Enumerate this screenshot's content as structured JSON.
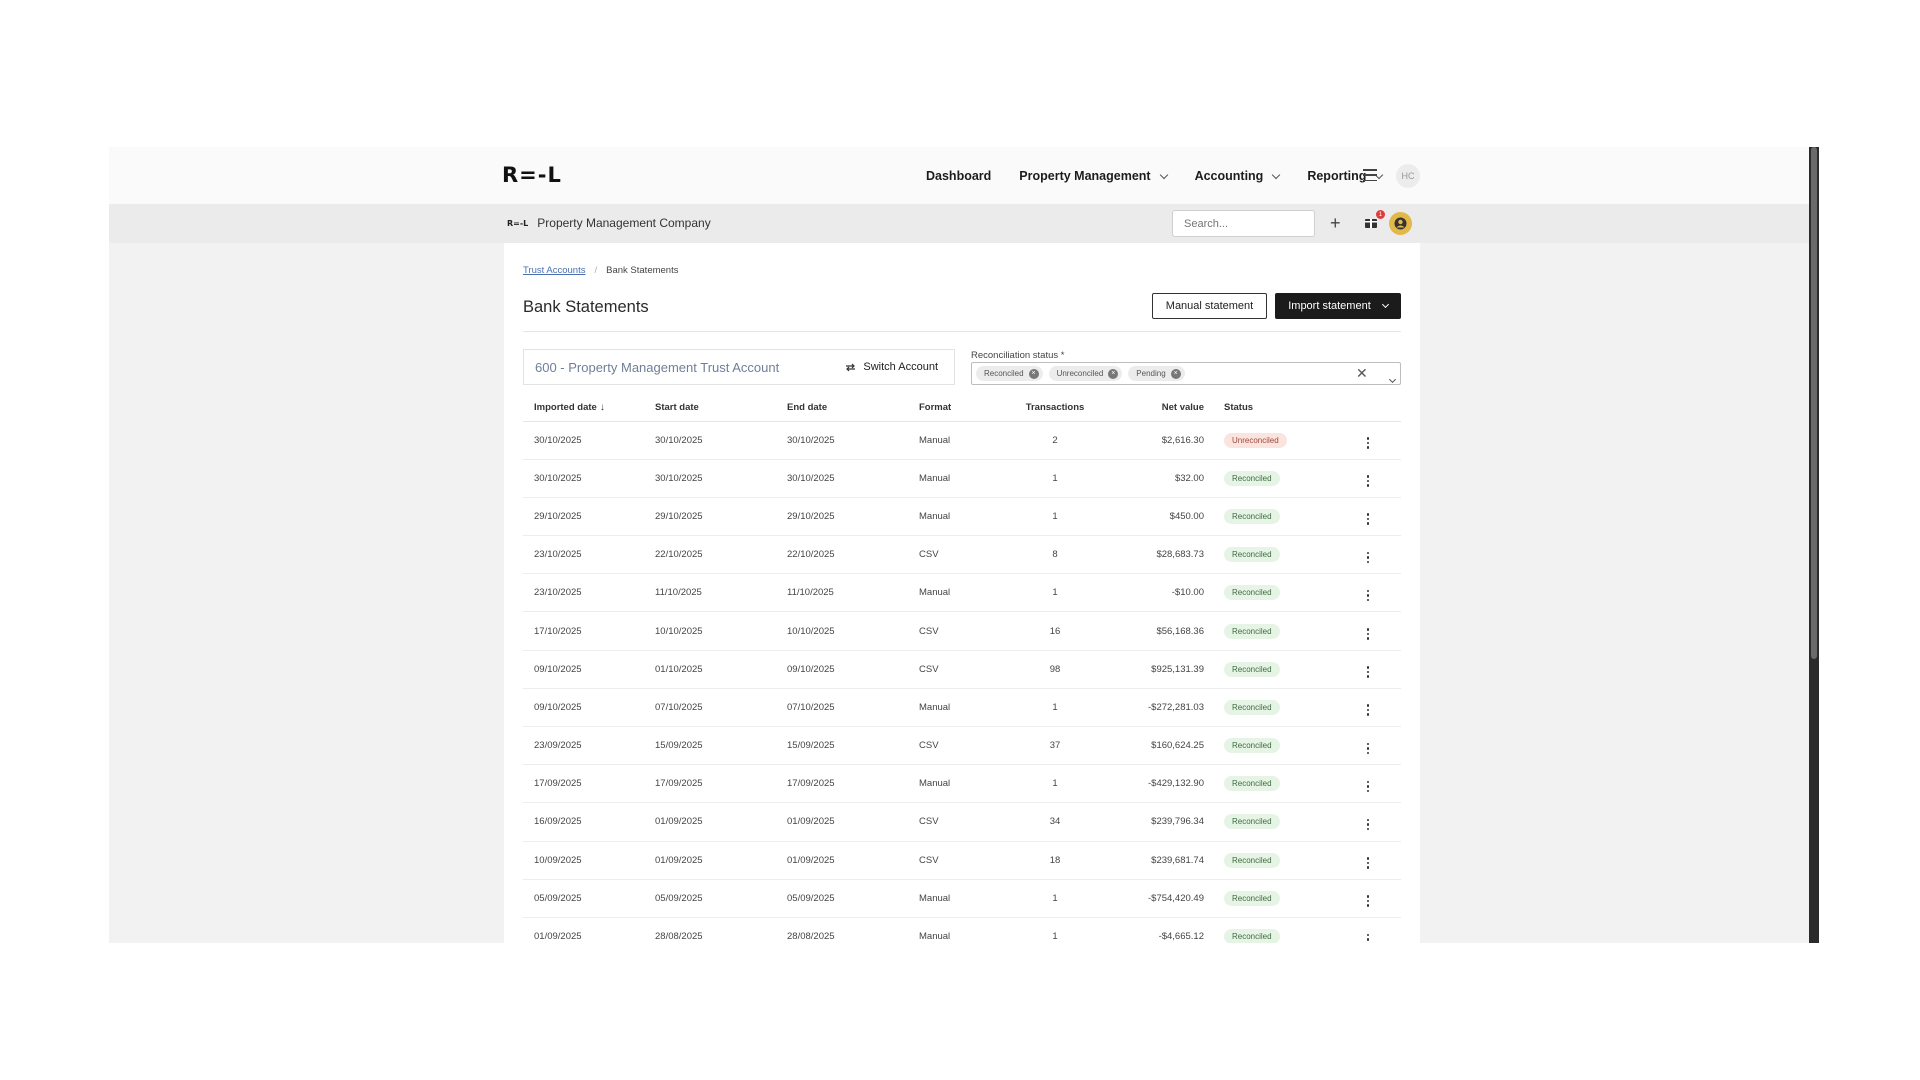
{
  "nav": {
    "logo": "R=-L",
    "items": [
      {
        "label": "Dashboard",
        "dropdown": false
      },
      {
        "label": "Property Management",
        "dropdown": true
      },
      {
        "label": "Accounting",
        "dropdown": true
      },
      {
        "label": "Reporting",
        "dropdown": true
      }
    ],
    "avatar_initials": "HC"
  },
  "subbar": {
    "company_logo": "R=-L",
    "company_name": "Property Management Company",
    "search_placeholder": "Search...",
    "notification_count": "1"
  },
  "breadcrumb": {
    "parent": "Trust Accounts",
    "separator": "/",
    "current": "Bank Statements"
  },
  "page": {
    "title": "Bank Statements",
    "manual_button": "Manual statement",
    "import_button": "Import statement"
  },
  "account": {
    "name": "600 - Property Management Trust Account",
    "switch_label": "Switch Account"
  },
  "filter": {
    "label": "Reconciliation status *",
    "chips": [
      "Reconciled",
      "Unreconciled",
      "Pending"
    ]
  },
  "table": {
    "headers": {
      "imported_date": "Imported date",
      "start_date": "Start date",
      "end_date": "End date",
      "format": "Format",
      "transactions": "Transactions",
      "net_value": "Net value",
      "status": "Status"
    },
    "rows": [
      {
        "imported": "30/10/2025",
        "start": "30/10/2025",
        "end": "30/10/2025",
        "format": "Manual",
        "tx": "2",
        "net": "$2,616.30",
        "status": "Unreconciled"
      },
      {
        "imported": "30/10/2025",
        "start": "30/10/2025",
        "end": "30/10/2025",
        "format": "Manual",
        "tx": "1",
        "net": "$32.00",
        "status": "Reconciled"
      },
      {
        "imported": "29/10/2025",
        "start": "29/10/2025",
        "end": "29/10/2025",
        "format": "Manual",
        "tx": "1",
        "net": "$450.00",
        "status": "Reconciled"
      },
      {
        "imported": "23/10/2025",
        "start": "22/10/2025",
        "end": "22/10/2025",
        "format": "CSV",
        "tx": "8",
        "net": "$28,683.73",
        "status": "Reconciled"
      },
      {
        "imported": "23/10/2025",
        "start": "11/10/2025",
        "end": "11/10/2025",
        "format": "Manual",
        "tx": "1",
        "net": "-$10.00",
        "status": "Reconciled"
      },
      {
        "imported": "17/10/2025",
        "start": "10/10/2025",
        "end": "10/10/2025",
        "format": "CSV",
        "tx": "16",
        "net": "$56,168.36",
        "status": "Reconciled"
      },
      {
        "imported": "09/10/2025",
        "start": "01/10/2025",
        "end": "09/10/2025",
        "format": "CSV",
        "tx": "98",
        "net": "$925,131.39",
        "status": "Reconciled"
      },
      {
        "imported": "09/10/2025",
        "start": "07/10/2025",
        "end": "07/10/2025",
        "format": "Manual",
        "tx": "1",
        "net": "-$272,281.03",
        "status": "Reconciled"
      },
      {
        "imported": "23/09/2025",
        "start": "15/09/2025",
        "end": "15/09/2025",
        "format": "CSV",
        "tx": "37",
        "net": "$160,624.25",
        "status": "Reconciled"
      },
      {
        "imported": "17/09/2025",
        "start": "17/09/2025",
        "end": "17/09/2025",
        "format": "Manual",
        "tx": "1",
        "net": "-$429,132.90",
        "status": "Reconciled"
      },
      {
        "imported": "16/09/2025",
        "start": "01/09/2025",
        "end": "01/09/2025",
        "format": "CSV",
        "tx": "34",
        "net": "$239,796.34",
        "status": "Reconciled"
      },
      {
        "imported": "10/09/2025",
        "start": "01/09/2025",
        "end": "01/09/2025",
        "format": "CSV",
        "tx": "18",
        "net": "$239,681.74",
        "status": "Reconciled"
      },
      {
        "imported": "05/09/2025",
        "start": "05/09/2025",
        "end": "05/09/2025",
        "format": "Manual",
        "tx": "1",
        "net": "-$754,420.49",
        "status": "Reconciled"
      },
      {
        "imported": "01/09/2025",
        "start": "28/08/2025",
        "end": "28/08/2025",
        "format": "Manual",
        "tx": "1",
        "net": "-$4,665.12",
        "status": "Reconciled"
      }
    ]
  },
  "colors": {
    "primary_button": "#1b1b1b",
    "reconciled_bg": "#e6f4e6",
    "unreconciled_bg": "#fbe3de",
    "user_icon": "#e2b84a",
    "notification": "#e03d3d"
  },
  "icons": [
    "chevron-down-icon",
    "hamburger-icon",
    "plus-icon",
    "gift-icon",
    "user-icon",
    "switch-icon",
    "close-icon",
    "kebab-icon",
    "sort-arrow-icon"
  ]
}
